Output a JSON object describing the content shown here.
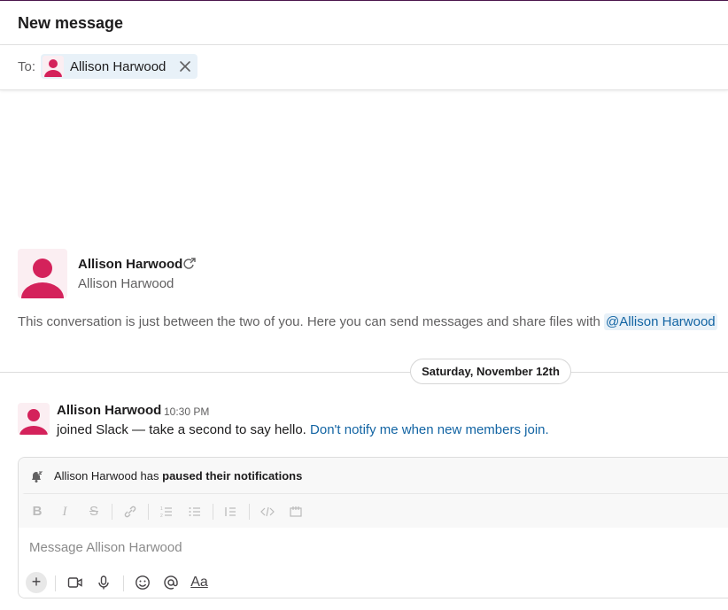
{
  "header": {
    "title": "New message"
  },
  "to_field": {
    "label": "To:",
    "recipient": "Allison Harwood"
  },
  "intro": {
    "name": "Allison Harwood",
    "display_name": "Allison Harwood",
    "description": "This conversation is just between the two of you. Here you can send messages and share files with",
    "mention": "@Allison Harwood"
  },
  "divider": {
    "date": "Saturday, November 12th"
  },
  "message": {
    "author": "Allison Harwood",
    "time": "10:30 PM",
    "text": "joined Slack — take a second to say hello.",
    "link": "Don't notify me when new members join."
  },
  "composer": {
    "notice_name": "Allison Harwood has",
    "notice_bold": "paused their notifications",
    "placeholder": "Message Allison Harwood",
    "format_buttons": [
      "bold",
      "italic",
      "strikethrough",
      "link",
      "ordered-list",
      "bulleted-list",
      "blockquote",
      "code",
      "code-block"
    ],
    "formatting_label": "Aa"
  },
  "colors": {
    "accent": "#1264a3",
    "avatar": "#d4225b",
    "avatar_bg": "#fbeef2",
    "topbar": "#4a154b"
  }
}
